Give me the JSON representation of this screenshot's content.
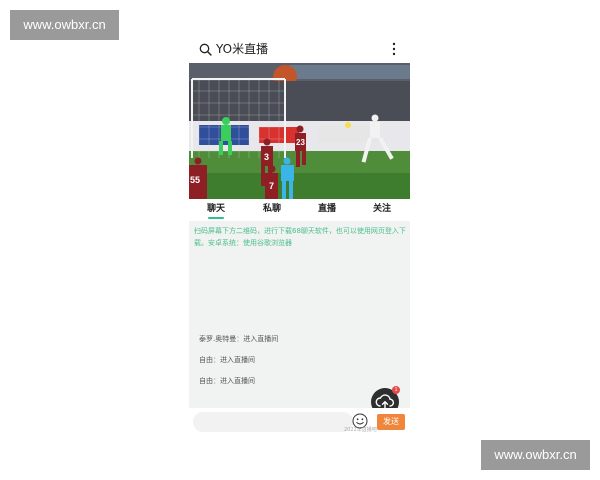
{
  "watermarks": {
    "top": "www.owbxr.cn",
    "bottom": "www.owbxr.cn"
  },
  "header": {
    "title": "YO米直播"
  },
  "video": {
    "player_numbers": [
      "3",
      "23",
      "55",
      "7"
    ]
  },
  "tabs": [
    {
      "label": "聊天"
    },
    {
      "label": "私聊"
    },
    {
      "label": "直播"
    },
    {
      "label": "关注"
    }
  ],
  "chat": {
    "notice": "扫码屏幕下方二维码，进行下载68聊天软件，也可以使用网页登入下载。安卓系统：使用谷歌浏览器",
    "messages": [
      {
        "user": "泰罗.奥特曼",
        "text": "进入直播间"
      },
      {
        "user": "自由",
        "text": "进入直播间"
      },
      {
        "user": "自由",
        "text": "进入直播间"
      }
    ],
    "separator": "：",
    "badge_count": "1"
  },
  "footer": {
    "send_label": "发送",
    "caption": "2022年直播吧"
  },
  "colors": {
    "accent": "#2fbf8f",
    "send": "#f0863c",
    "notice_text": "#4cbf8b",
    "badge": "#e34a4a"
  },
  "icons": {
    "search": "search-icon",
    "more": "more-vertical-icon",
    "upload": "cloud-upload-icon",
    "emoji": "smile-icon"
  }
}
